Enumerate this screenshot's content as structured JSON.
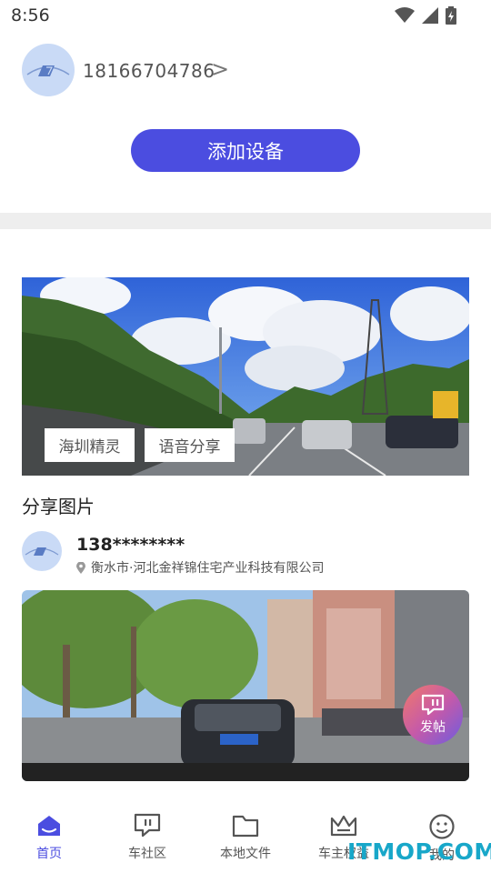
{
  "status_bar": {
    "time": "8:56"
  },
  "profile": {
    "phone": "18166704786",
    "chevron": ">"
  },
  "add_device_label": "添加设备",
  "banner": {
    "tags": [
      "海圳精灵",
      "语音分享"
    ]
  },
  "section": {
    "title": "分享图片"
  },
  "post": {
    "user": "138********",
    "location": "衡水市·河北金祥锦住宅产业科技有限公司"
  },
  "fab": {
    "label": "发帖"
  },
  "nav": {
    "items": [
      {
        "label": "首页",
        "icon": "home-icon",
        "active": true
      },
      {
        "label": "车社区",
        "icon": "community-icon"
      },
      {
        "label": "本地文件",
        "icon": "folder-icon"
      },
      {
        "label": "车主权益",
        "icon": "crown-icon"
      },
      {
        "label": "我的",
        "icon": "profile-icon"
      }
    ]
  },
  "watermark": "ITMOP.COM",
  "colors": {
    "accent": "#4b4de0",
    "divider": "#eeeeee",
    "avatar_bg": "#c9daf6"
  }
}
